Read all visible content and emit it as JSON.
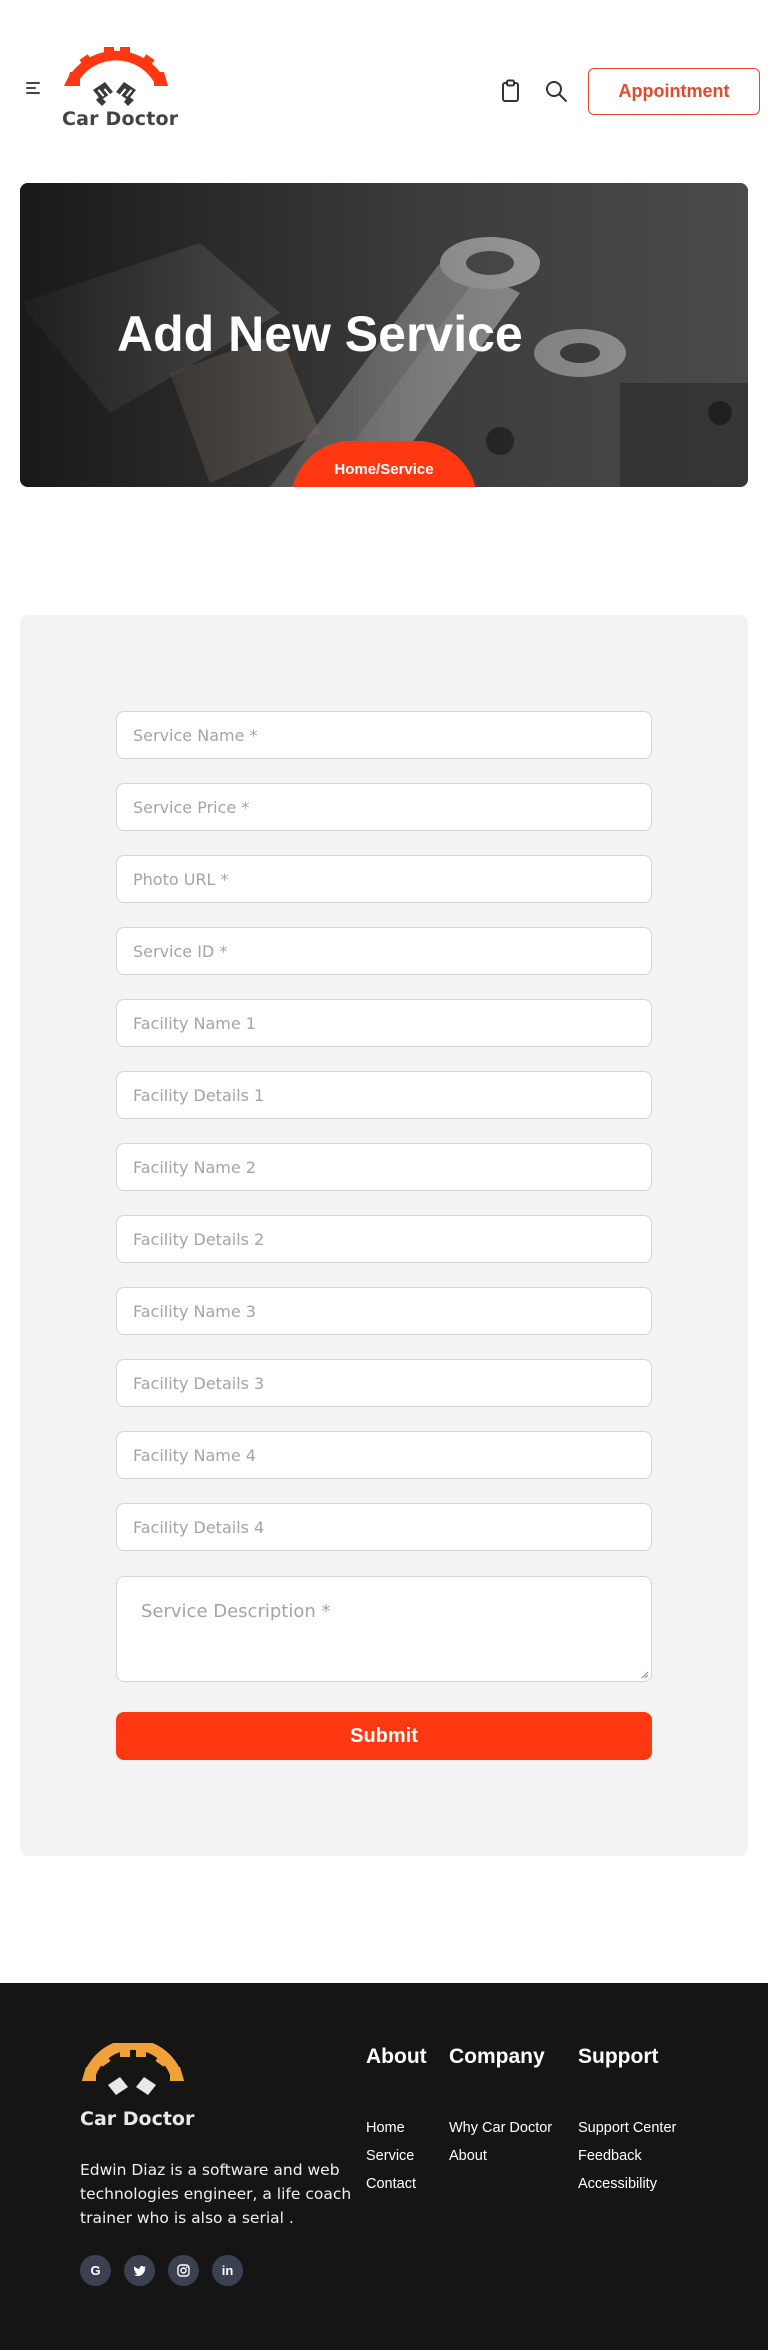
{
  "header": {
    "brand": "Car Doctor",
    "appointment_label": "Appointment",
    "icons": [
      "menu-icon",
      "clipboard-icon",
      "search-icon"
    ]
  },
  "banner": {
    "title": "Add New Service",
    "breadcrumb": "Home/Service"
  },
  "form": {
    "fields": [
      {
        "placeholder": "Service Name *",
        "value": ""
      },
      {
        "placeholder": "Service Price *",
        "value": ""
      },
      {
        "placeholder": "Photo URL *",
        "value": ""
      },
      {
        "placeholder": "Service ID *",
        "value": ""
      },
      {
        "placeholder": "Facility Name 1",
        "value": ""
      },
      {
        "placeholder": "Facility Details 1",
        "value": ""
      },
      {
        "placeholder": "Facility Name 2",
        "value": ""
      },
      {
        "placeholder": "Facility Details 2",
        "value": ""
      },
      {
        "placeholder": "Facility Name 3",
        "value": ""
      },
      {
        "placeholder": "Facility Details 3",
        "value": ""
      },
      {
        "placeholder": "Facility Name 4",
        "value": ""
      },
      {
        "placeholder": "Facility Details 4",
        "value": ""
      }
    ],
    "description_placeholder": "Service Description *",
    "submit_label": "Submit"
  },
  "footer": {
    "brand": "Car Doctor",
    "description": "Edwin Diaz is a software and web technologies engineer, a life coach trainer who is also a serial .",
    "social": [
      "G",
      "t",
      "o",
      "in"
    ],
    "columns": [
      {
        "title": "About",
        "links": [
          "Home",
          "Service",
          "Contact"
        ]
      },
      {
        "title": "Company",
        "links": [
          "Why Car Doctor",
          "About"
        ]
      },
      {
        "title": "Support",
        "links": [
          "Support Center",
          "Feedback",
          "Accessibility"
        ]
      }
    ]
  },
  "colors": {
    "accent": "#ff3811",
    "accent_border": "#e5482a",
    "footer_bg": "#151515",
    "panel_bg": "#f3f3f3",
    "logo_footer": "#f0a13a"
  }
}
